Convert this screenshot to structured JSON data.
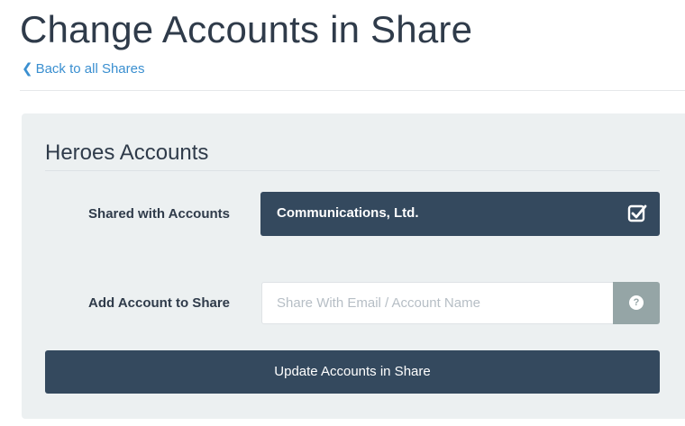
{
  "page": {
    "title": "Change Accounts in Share",
    "back_link": "Back to all Shares"
  },
  "section": {
    "title": "Heroes Accounts"
  },
  "shared_accounts": {
    "label": "Shared with Accounts",
    "items": [
      {
        "name": "Communications, Ltd.",
        "checked": true
      }
    ]
  },
  "add_account": {
    "label": "Add Account to Share",
    "value": "",
    "placeholder": "Share With Email / Account Name",
    "help_icon": "question-circle-icon",
    "help_glyph": "?"
  },
  "actions": {
    "update_label": "Update Accounts in Share"
  },
  "colors": {
    "primary_dark": "#34495e",
    "panel_bg": "#ecf0f1",
    "link": "#3a8fd0",
    "addon_gray": "#95a5a6"
  }
}
